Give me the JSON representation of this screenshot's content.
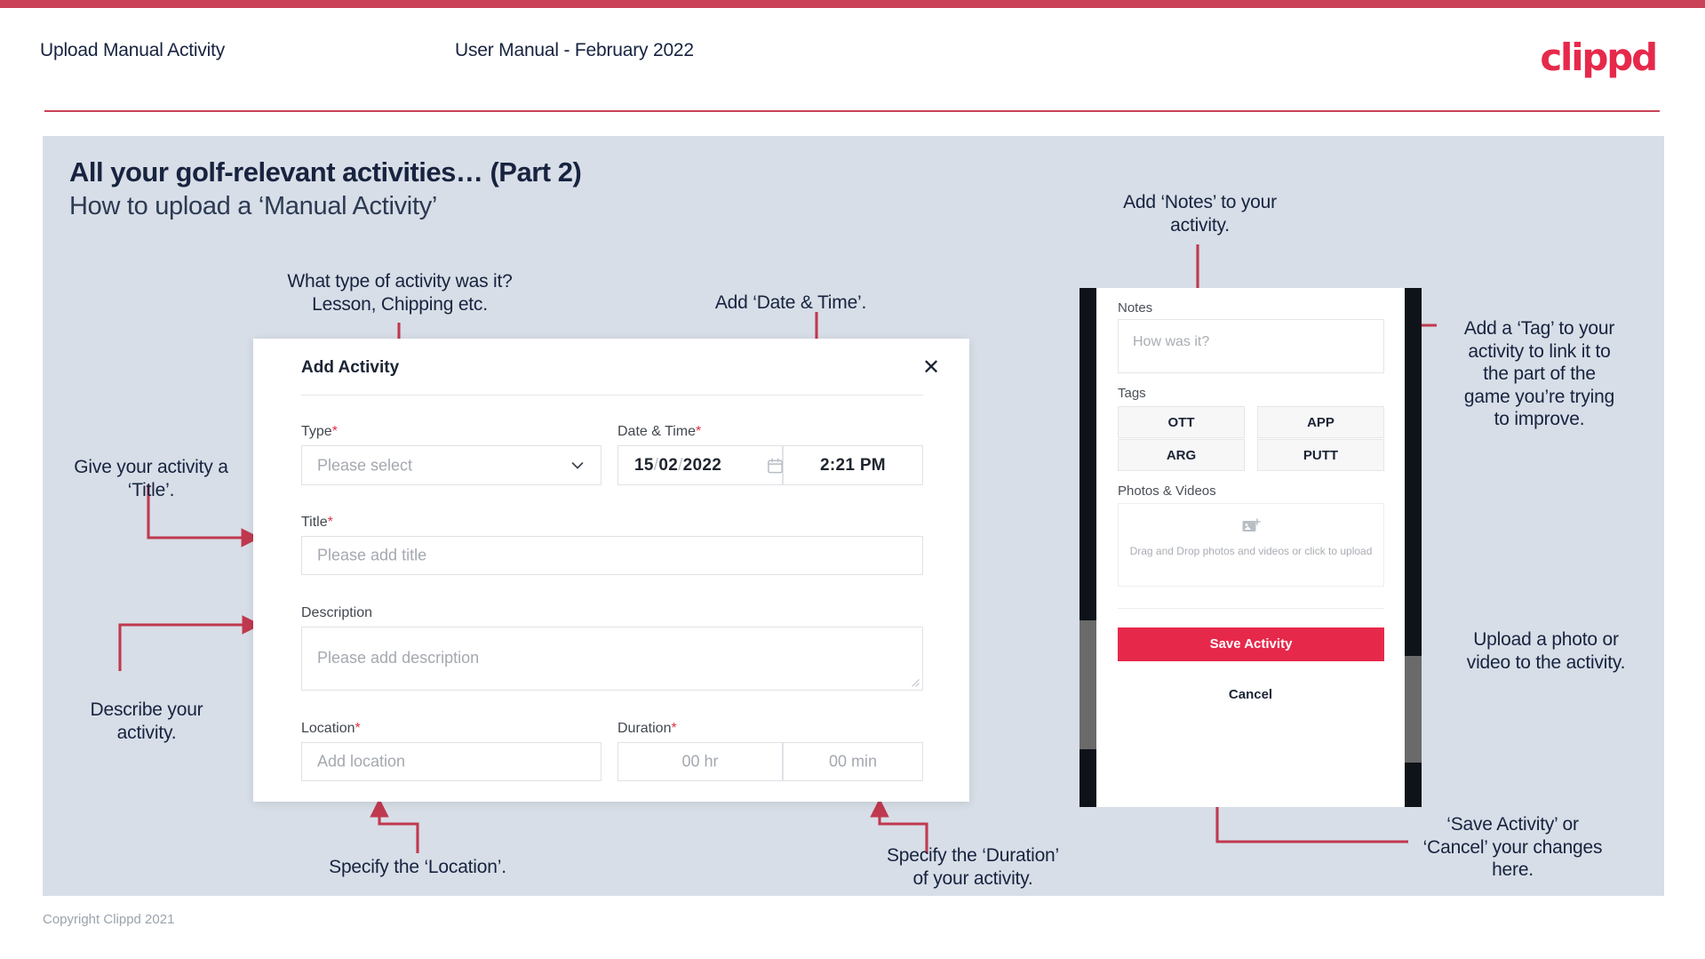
{
  "header": {
    "title": "Upload Manual Activity",
    "subtitle": "User Manual - February 2022",
    "brand": "clippd"
  },
  "slide": {
    "title": "All your golf-relevant activities… (Part 2)",
    "subtitle": "How to upload a ‘Manual Activity’",
    "copyright": "Copyright Clippd 2021"
  },
  "annotations": {
    "type": "What type of activity was it?\nLesson, Chipping etc.",
    "datetime": "Add ‘Date & Time’.",
    "title": "Give your activity a\n‘Title’.",
    "description": "Describe your\nactivity.",
    "location": "Specify the ‘Location’.",
    "duration": "Specify the ‘Duration’\nof your activity.",
    "notes": "Add ‘Notes’ to your\nactivity.",
    "tags": "Add a ‘Tag’ to your\nactivity to link it to\nthe part of the\ngame you’re trying\nto improve.",
    "upload": "Upload a photo or\nvideo to the activity.",
    "save": "‘Save Activity’ or\n‘Cancel’ your changes\nhere."
  },
  "dialog": {
    "title": "Add Activity",
    "close_icon": "close-icon",
    "fields": {
      "type": {
        "label": "Type",
        "required": "*",
        "placeholder": "Please select",
        "icon": "chevron-down-icon"
      },
      "datetime": {
        "label": "Date & Time",
        "required": "*",
        "day": "15",
        "month": "02",
        "year": "2022",
        "separator": "/",
        "time": "2:21 PM",
        "icon": "calendar-icon"
      },
      "title": {
        "label": "Title",
        "required": "*",
        "placeholder": "Please add title"
      },
      "description": {
        "label": "Description",
        "required": "",
        "placeholder": "Please add description"
      },
      "location": {
        "label": "Location",
        "required": "*",
        "placeholder": "Add location"
      },
      "duration": {
        "label": "Duration",
        "required": "*",
        "hours_placeholder": "00 hr",
        "minutes_placeholder": "00 min"
      }
    }
  },
  "phone": {
    "notes": {
      "label": "Notes",
      "placeholder": "How was it?"
    },
    "tags": {
      "label": "Tags",
      "items": [
        "OTT",
        "APP",
        "ARG",
        "PUTT"
      ]
    },
    "photos": {
      "label": "Photos & Videos",
      "drop_text": "Drag and Drop photos and videos or click to upload",
      "icon": "add-image-icon"
    },
    "save_label": "Save Activity",
    "cancel_label": "Cancel"
  },
  "colors": {
    "brand": "#e6294b",
    "accent_bar": "#c94258",
    "slide_bg": "#d7dee7",
    "text_dark": "#17233f",
    "arrow": "#c0394f"
  }
}
